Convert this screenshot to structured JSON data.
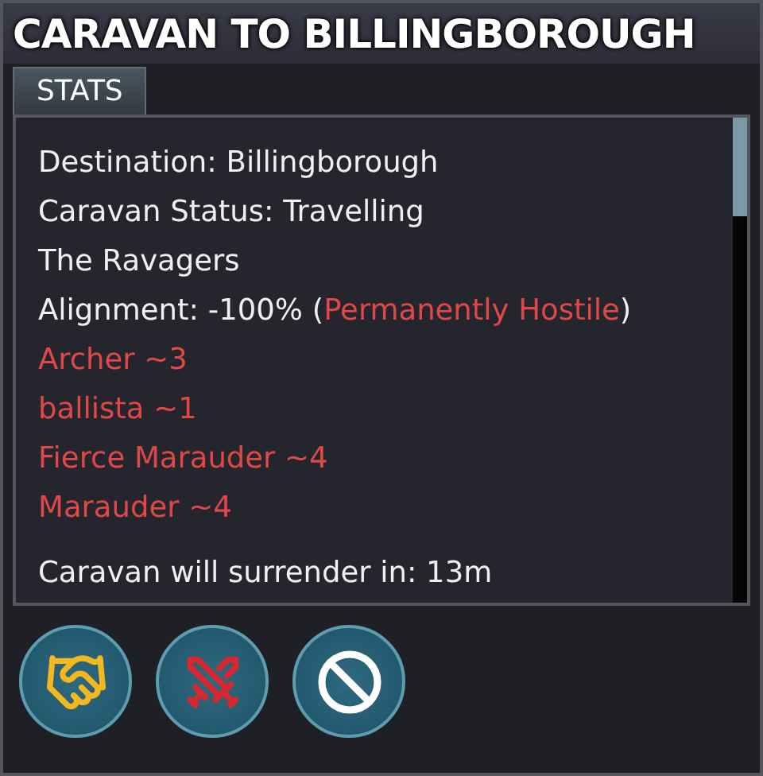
{
  "window": {
    "title": "CARAVAN TO BILLINGBOROUGH"
  },
  "tabs": [
    {
      "label": "STATS",
      "selected": true
    }
  ],
  "stats": [
    {
      "parts": [
        {
          "text": "Destination: Billingborough",
          "hostile": false
        }
      ]
    },
    {
      "parts": [
        {
          "text": "Caravan Status: Travelling",
          "hostile": false
        }
      ]
    },
    {
      "parts": [
        {
          "text": "The Ravagers",
          "hostile": false
        }
      ]
    },
    {
      "parts": [
        {
          "text": "Alignment: -100% (",
          "hostile": false
        },
        {
          "text": "Permanently Hostile",
          "hostile": true
        },
        {
          "text": ")",
          "hostile": false
        }
      ]
    },
    {
      "parts": [
        {
          "text": "Archer ~3",
          "hostile": true
        }
      ]
    },
    {
      "parts": [
        {
          "text": "ballista ~1",
          "hostile": true
        }
      ]
    },
    {
      "parts": [
        {
          "text": "Fierce Marauder ~4",
          "hostile": true
        }
      ]
    },
    {
      "parts": [
        {
          "text": "Marauder ~4",
          "hostile": true
        }
      ]
    }
  ],
  "footer": "Caravan will surrender in: 13m",
  "actions": [
    {
      "kind": "trade"
    },
    {
      "kind": "attack"
    },
    {
      "kind": "cancel"
    }
  ]
}
